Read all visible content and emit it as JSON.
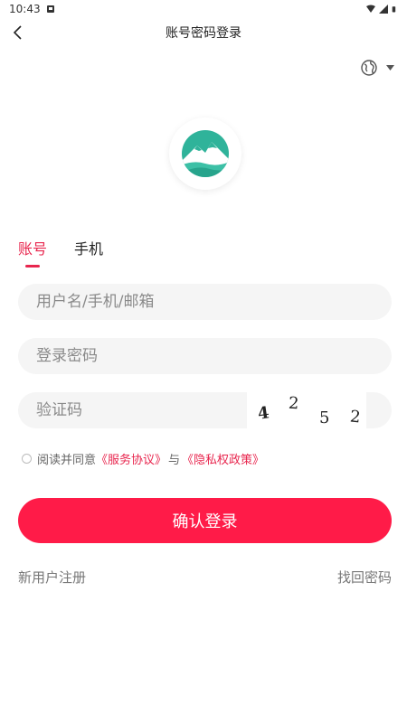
{
  "status_bar": {
    "time": "10:43"
  },
  "header": {
    "title": "账号密码登录"
  },
  "tabs": [
    {
      "label": "账号",
      "active": true
    },
    {
      "label": "手机",
      "active": false
    }
  ],
  "fields": {
    "username_placeholder": "用户名/手机/邮箱",
    "password_placeholder": "登录密码",
    "captcha_placeholder": "验证码"
  },
  "captcha": {
    "chars": [
      "4",
      "2",
      "5",
      "2"
    ]
  },
  "agreement": {
    "prefix": "阅读并同意",
    "service_link": "《服务协议》",
    "joiner": "与",
    "privacy_link": "《隐私权政策》"
  },
  "login_button": "确认登录",
  "bottom": {
    "register": "新用户注册",
    "forgot_password": "找回密码"
  },
  "colors": {
    "accent": "#e8264e",
    "button": "#ff1b48",
    "logo_teal": "#2fb39a"
  }
}
